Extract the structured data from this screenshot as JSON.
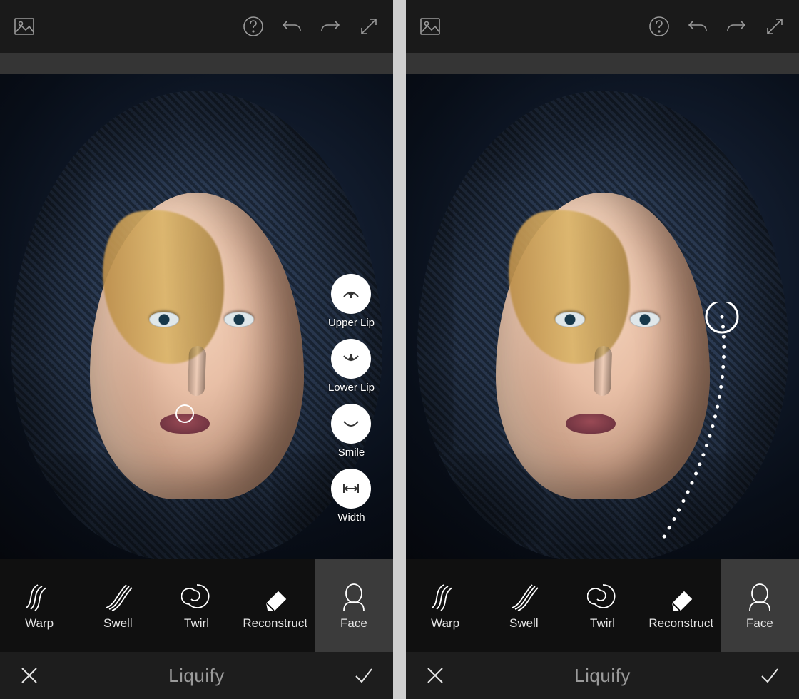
{
  "left": {
    "tools": [
      {
        "label": "Warp"
      },
      {
        "label": "Swell"
      },
      {
        "label": "Twirl"
      },
      {
        "label": "Reconstruct"
      },
      {
        "label": "Face"
      }
    ],
    "options": [
      {
        "label": "Upper Lip"
      },
      {
        "label": "Lower Lip"
      },
      {
        "label": "Smile"
      },
      {
        "label": "Width"
      }
    ],
    "title": "Liquify"
  },
  "right": {
    "tools": [
      {
        "label": "Warp"
      },
      {
        "label": "Swell"
      },
      {
        "label": "Twirl"
      },
      {
        "label": "Reconstruct"
      },
      {
        "label": "Face"
      }
    ],
    "title": "Liquify"
  }
}
